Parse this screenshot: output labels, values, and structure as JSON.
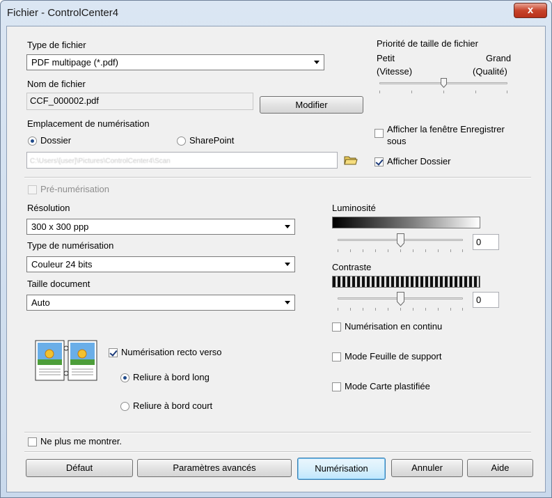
{
  "window": {
    "title": "Fichier - ControlCenter4",
    "close_glyph": "x"
  },
  "file_type": {
    "label": "Type de fichier",
    "value": "PDF multipage (*.pdf)"
  },
  "file_size_priority": {
    "label": "Priorité de taille de fichier",
    "small_label": "Petit",
    "large_label": "Grand",
    "speed_label": "(Vitesse)",
    "quality_label": "(Qualité)"
  },
  "file_name": {
    "label": "Nom de fichier",
    "value": "CCF_000002.pdf",
    "modify_label": "Modifier"
  },
  "scan_location": {
    "label": "Emplacement de numérisation",
    "folder_label": "Dossier",
    "sharepoint_label": "SharePoint",
    "path": "C:\\Users\\[user]\\Pictures\\ControlCenter4\\Scan",
    "show_save_as_label_1": "Afficher la fenêtre Enregistrer",
    "show_save_as_label_2": "sous",
    "show_folder_label": "Afficher Dossier"
  },
  "prescan": {
    "label": "Pré-numérisation"
  },
  "resolution": {
    "label": "Résolution",
    "value": "300 x 300 ppp"
  },
  "scan_type": {
    "label": "Type de numérisation",
    "value": "Couleur 24 bits"
  },
  "document_size": {
    "label": "Taille document",
    "value": "Auto"
  },
  "brightness": {
    "label": "Luminosité",
    "value": "0"
  },
  "contrast": {
    "label": "Contraste",
    "value": "0"
  },
  "duplex": {
    "label": "Numérisation recto verso",
    "long_edge_label": "Reliure à bord long",
    "short_edge_label": "Reliure à bord court"
  },
  "options": {
    "continuous_label": "Numérisation en continu",
    "carrier_sheet_label": "Mode Feuille de support",
    "plastic_card_label": "Mode Carte plastifiée"
  },
  "dont_show_label": "Ne plus me montrer.",
  "buttons": {
    "default_label": "Défaut",
    "advanced_label": "Paramètres avancés",
    "scan_label": "Numérisation",
    "cancel_label": "Annuler",
    "help_label": "Aide"
  }
}
